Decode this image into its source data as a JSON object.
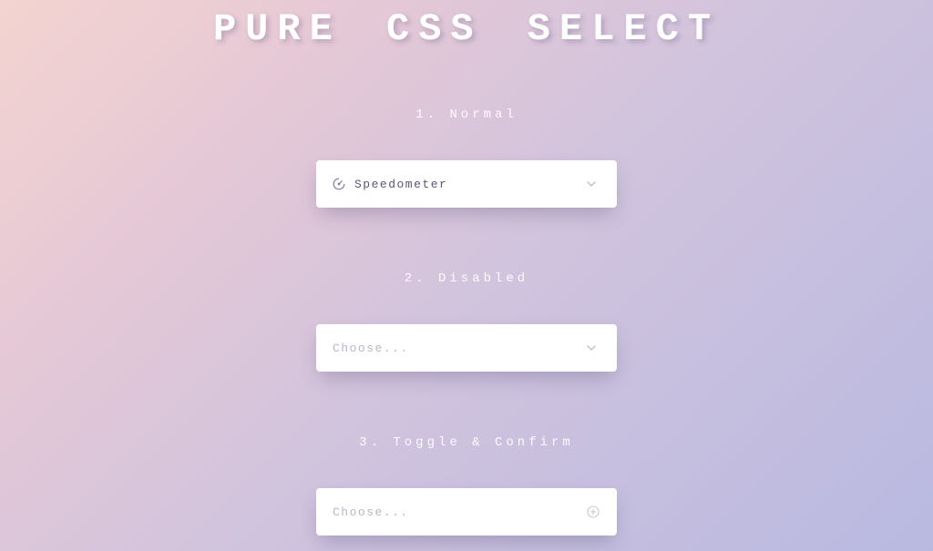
{
  "title": "PURE CSS SELECT",
  "sections": {
    "normal": {
      "label": "1. Normal",
      "selected": "Speedometer"
    },
    "disabled": {
      "label": "2. Disabled",
      "placeholder": "Choose..."
    },
    "toggle": {
      "label": "3. Toggle & Confirm",
      "placeholder": "Choose..."
    }
  }
}
